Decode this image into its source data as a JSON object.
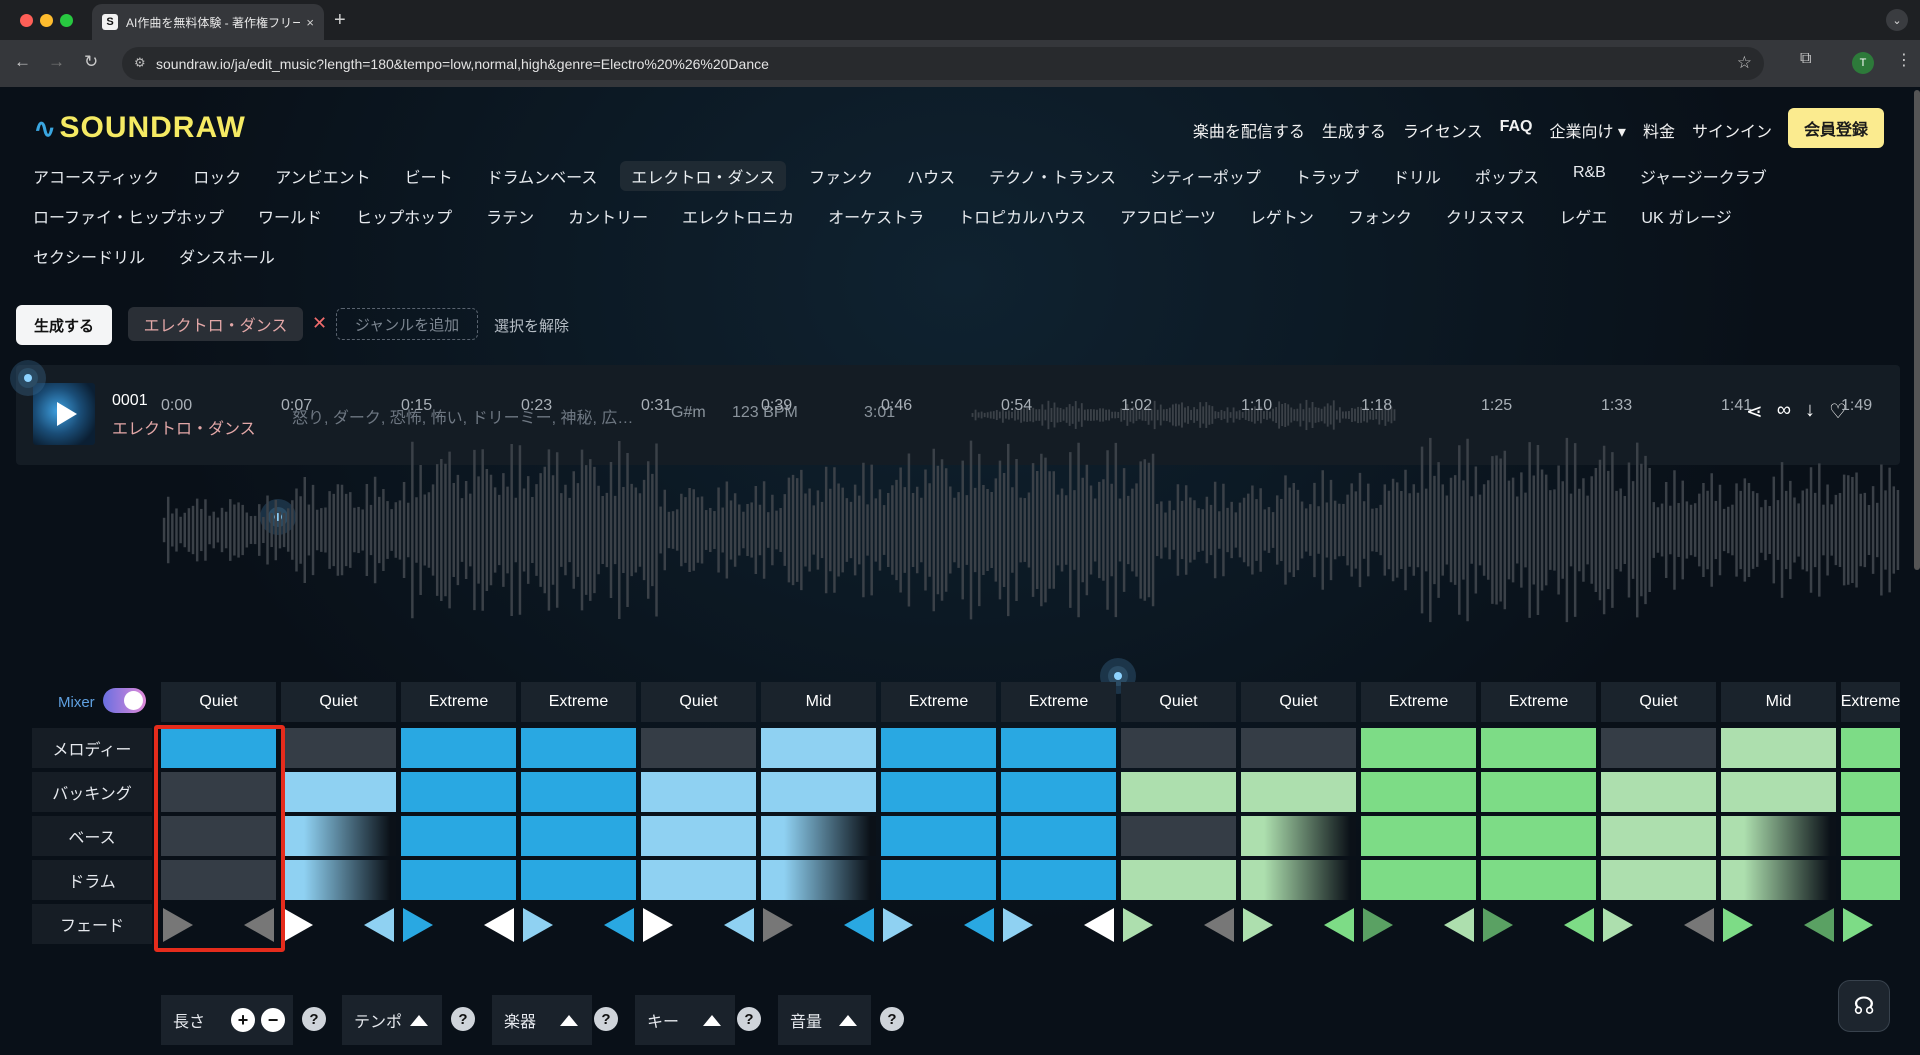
{
  "browser": {
    "tab_title": "AI作曲を無料体験 - 著作権フリー…",
    "tab_favicon": "S",
    "tab_close": "×",
    "new_tab": "+",
    "url": "soundraw.io/ja/edit_music?length=180&tempo=low,normal,high&genre=Electro%20%26%20Dance",
    "profile_initial": "T"
  },
  "header": {
    "logo": "SOUNDRAW",
    "nav": [
      "楽曲を配信する",
      "生成する",
      "ライセンス",
      "FAQ",
      "企業向け ▾",
      "料金",
      "サインイン"
    ],
    "signup": "会員登録"
  },
  "genres": {
    "row1": [
      "アコースティック",
      "ロック",
      "アンビエント",
      "ビート",
      "ドラムンベース",
      "エレクトロ・ダンス",
      "ファンク",
      "ハウス",
      "テクノ・トランス",
      "シティーポップ",
      "トラップ",
      "ドリル",
      "ポップス",
      "R&B",
      "ジャージークラブ"
    ],
    "row2": [
      "ローファイ・ヒップホップ",
      "ワールド",
      "ヒップホップ",
      "ラテン",
      "カントリー",
      "エレクトロニカ",
      "オーケストラ",
      "トロピカルハウス",
      "アフロビーツ",
      "レゲトン",
      "フォンク",
      "クリスマス",
      "レゲエ",
      "UK ガレージ"
    ],
    "row3": [
      "セクシードリル",
      "ダンスホール"
    ],
    "selected": "エレクトロ・ダンス"
  },
  "filters": {
    "generate": "生成する",
    "chip": "エレクトロ・ダンス",
    "chip_remove": "✕",
    "add_genre": "ジャンルを追加",
    "clear": "選択を解除"
  },
  "track": {
    "number": "0001",
    "genre": "エレクトロ・ダンス",
    "moods": "怒り, ダーク, 恐怖, 怖い, ドリーミー, 神秘, 広…",
    "key": "G#m",
    "bpm": "123 BPM",
    "length": "3:01"
  },
  "timeline": [
    "0:00",
    "0:07",
    "0:15",
    "0:23",
    "0:31",
    "0:39",
    "0:46",
    "0:54",
    "1:02",
    "1:10",
    "1:18",
    "1:25",
    "1:33",
    "1:41",
    "1:49"
  ],
  "mixer": {
    "label": "Mixer",
    "enabled": true,
    "rows": [
      "メロディー",
      "バッキング",
      "ベース",
      "ドラム",
      "フェード"
    ],
    "segments": [
      "Quiet",
      "Quiet",
      "Extreme",
      "Extreme",
      "Quiet",
      "Mid",
      "Extreme",
      "Extreme",
      "Quiet",
      "Quiet",
      "Extreme",
      "Extreme",
      "Quiet",
      "Mid",
      "Extreme"
    ],
    "colors": {
      "blue_strong": "#29a8e2",
      "blue_light": "#8fd1f2",
      "green_strong": "#7ddc86",
      "green_light": "#addfae",
      "empty": "#353d46",
      "selection": "#e52c1c"
    }
  },
  "controls": {
    "length": "長さ",
    "tempo": "テンポ",
    "instruments": "楽器",
    "key": "キー",
    "volume": "音量",
    "help": "?",
    "plus": "+",
    "minus": "−"
  }
}
